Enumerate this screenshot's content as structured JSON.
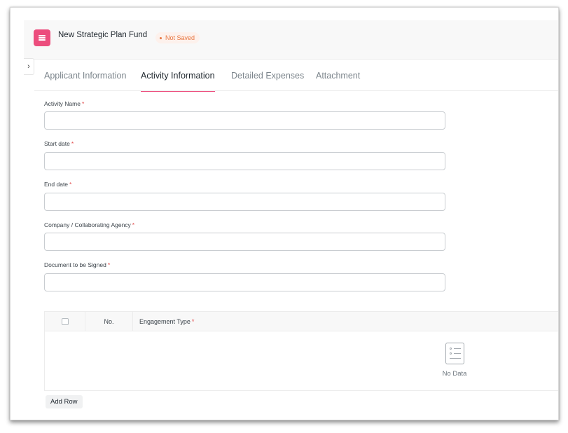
{
  "header": {
    "title": "New Strategic Plan Fund",
    "status_badge": "Not Saved"
  },
  "tabs": [
    {
      "label": "Applicant Information",
      "active": false
    },
    {
      "label": "Activity Information",
      "active": true
    },
    {
      "label": "Detailed Expenses",
      "active": false
    },
    {
      "label": "Attachment",
      "active": false
    }
  ],
  "form": {
    "fields": [
      {
        "label": "Activity Name",
        "required": true,
        "value": ""
      },
      {
        "label": "Start date",
        "required": true,
        "value": ""
      },
      {
        "label": "End date",
        "required": true,
        "value": ""
      },
      {
        "label": "Company / Collaborating Agency",
        "required": true,
        "value": ""
      },
      {
        "label": "Document to be Signed",
        "required": true,
        "value": ""
      }
    ]
  },
  "table": {
    "columns": {
      "no": "No.",
      "engagement_type": "Engagement Type"
    },
    "required_mark": "*",
    "empty_text": "No Data",
    "add_row_label": "Add Row"
  },
  "colors": {
    "accent": "#ec4d7d",
    "badge_text": "#e8753f",
    "badge_bg": "#fdf1ec",
    "required": "#e24c4c"
  },
  "icons": {
    "menu": "hamburger-menu-icon",
    "sidebar_toggle": "chevron-right-icon",
    "empty_state": "list-document-icon"
  }
}
